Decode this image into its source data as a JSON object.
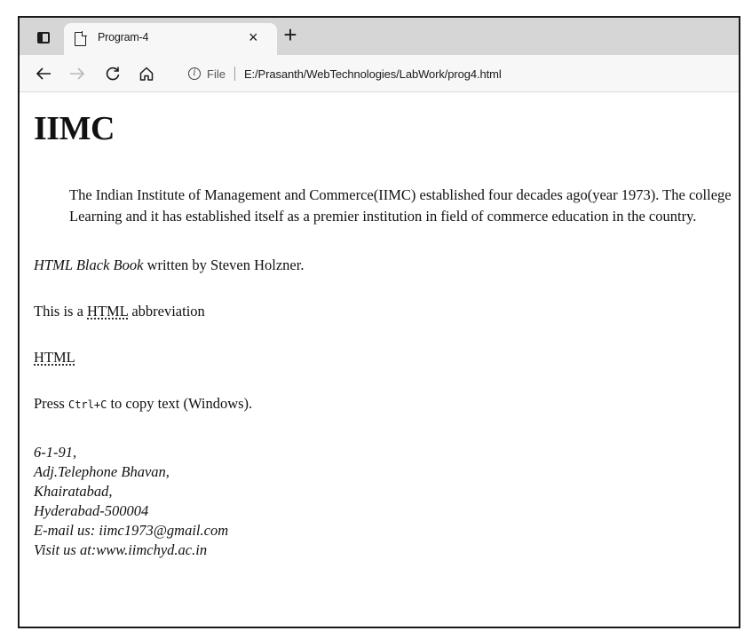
{
  "browser": {
    "tab_title": "Program-4",
    "tab_close": "×",
    "new_tab": "+",
    "address_label": "File",
    "url": "E:/Prasanth/WebTechnologies/LabWork/prog4.html",
    "icons": {
      "tab_actions": "tab-actions-icon",
      "page": "page-icon",
      "back": "back-arrow-icon",
      "forward": "forward-arrow-icon",
      "refresh": "refresh-icon",
      "home": "home-icon",
      "info": "info-icon"
    }
  },
  "page": {
    "heading": "IIMC",
    "blockquote_line1": "The Indian Institute of Management and Commerce(IIMC) established four decades ago(year 1973). The college",
    "blockquote_line2": "Learning and it has established itself as a premier institution in field of commerce education in the country.",
    "book_title": "HTML Black Book",
    "book_rest": " written by Steven Holzner.",
    "abbr_prefix": "This is a ",
    "abbr_text": "HTML",
    "abbr_suffix": " abbreviation",
    "standalone_abbr": "HTML",
    "press_prefix": "Press ",
    "kbd_text": "Ctrl+C",
    "press_suffix": " to copy text (Windows).",
    "address_lines": [
      "6-1-91,",
      "Adj.Telephone Bhavan,",
      "Khairatabad,",
      "Hyderabad-500004",
      "E-mail us: iimc1973@gmail.com",
      "Visit us at:www.iimchyd.ac.in"
    ]
  }
}
